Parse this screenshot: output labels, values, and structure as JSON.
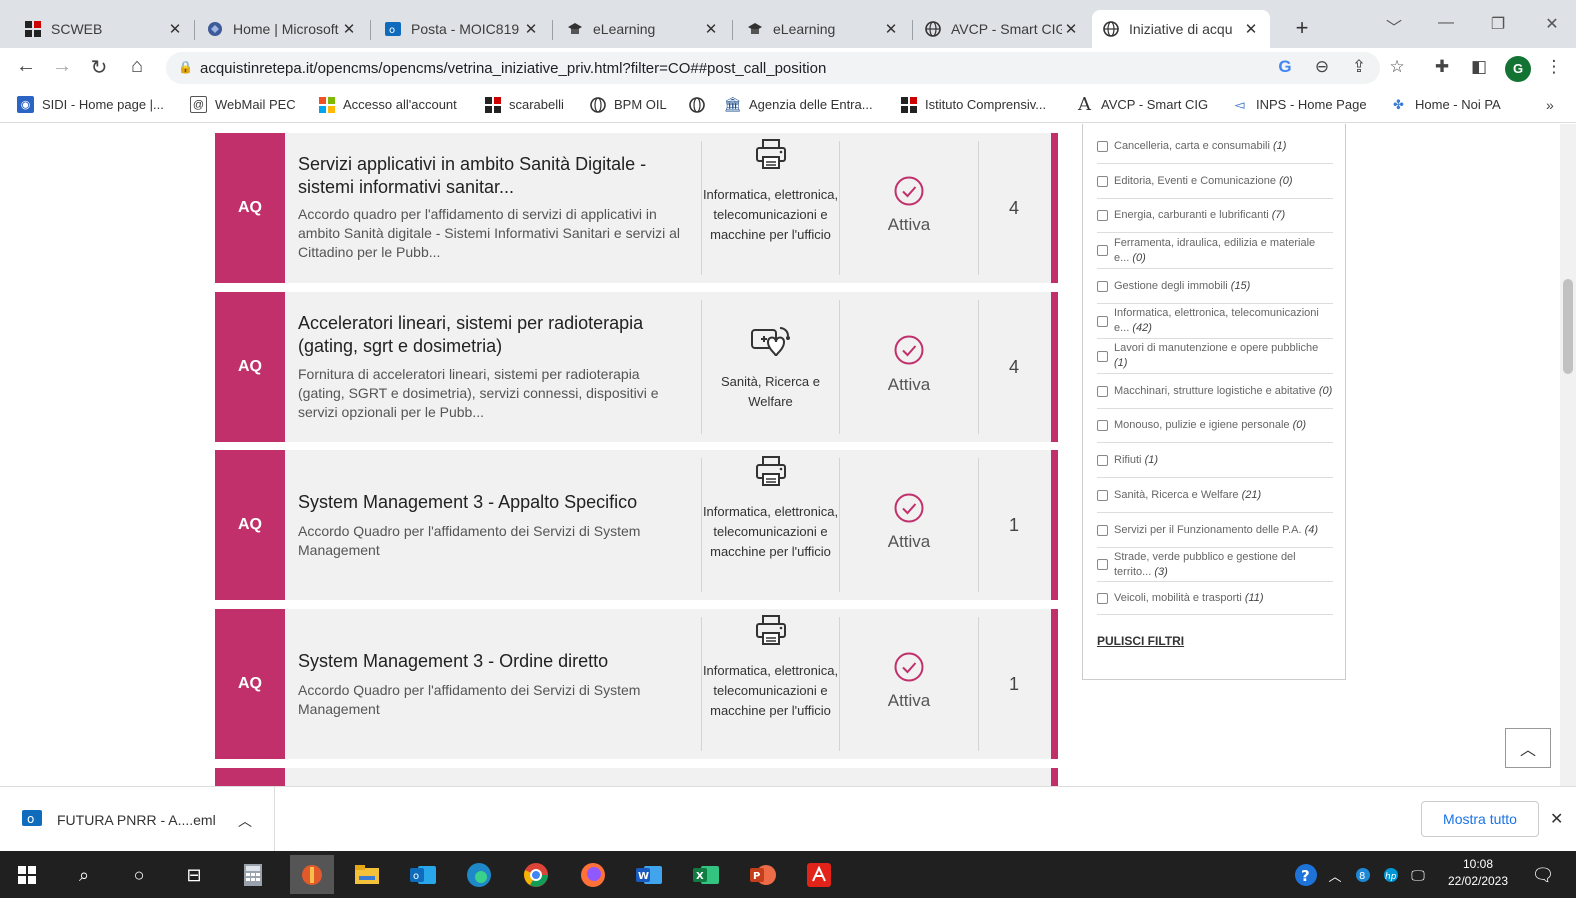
{
  "browser": {
    "tabs": [
      {
        "title": "SCWEB",
        "icon": "scweb-icon",
        "active": false
      },
      {
        "title": "Home | Microsoft",
        "icon": "microsoft-office-icon",
        "active": false
      },
      {
        "title": "Posta - MOIC819",
        "icon": "outlook-icon",
        "active": false
      },
      {
        "title": "eLearning",
        "icon": "elearning-icon",
        "active": false
      },
      {
        "title": "eLearning",
        "icon": "elearning-icon",
        "active": false
      },
      {
        "title": "AVCP - Smart CIG",
        "icon": "globe-icon",
        "active": false
      },
      {
        "title": "Iniziative di acqu",
        "icon": "globe-icon",
        "active": true
      }
    ],
    "url": "acquistinretepa.it/opencms/opencms/vetrina_iniziative_priv.html?filter=CO##post_call_position",
    "profile_initial": "G",
    "bookmarks": [
      {
        "label": "SIDI - Home page |...",
        "icon": "sidi-icon"
      },
      {
        "label": "WebMail PEC",
        "icon": "webmail-icon"
      },
      {
        "label": "Accesso all'account",
        "icon": "microsoft-icon"
      },
      {
        "label": "scarabelli",
        "icon": "scarabelli-icon"
      },
      {
        "label": "BPM OIL",
        "icon": "globe-icon"
      },
      {
        "label": "",
        "icon": "globe-icon"
      },
      {
        "label": "Agenzia delle Entra...",
        "icon": "agenzia-icon"
      },
      {
        "label": "Istituto Comprensiv...",
        "icon": "istituto-icon"
      },
      {
        "label": "AVCP - Smart CIG",
        "icon": "avcp-icon"
      },
      {
        "label": "INPS - Home Page",
        "icon": "inps-icon"
      },
      {
        "label": "Home - Noi PA",
        "icon": "noipa-icon"
      }
    ]
  },
  "initiatives": [
    {
      "badge": "AQ",
      "title": "Servizi applicativi in ambito Sanità Digitale - sistemi informativi sanitar...",
      "description": "Accordo quadro per l'affidamento di servizi di applicativi in ambito Sanità digitale - Sistemi Informativi Sanitari e servizi al Cittadino per le Pubb...",
      "category": "Informatica, elettronica, telecomunicazioni e macchine per l'ufficio",
      "category_icon": "printer-icon",
      "status": "Attiva",
      "count": "4"
    },
    {
      "badge": "AQ",
      "title": "Acceleratori lineari, sistemi per radioterapia (gating, sgrt e dosimetria)",
      "description": "Fornitura di acceleratori lineari, sistemi per radioterapia (gating, SGRT e dosimetria), servizi connessi, dispositivi e servizi opzionali per le Pubb...",
      "category": "Sanità, Ricerca e Welfare",
      "category_icon": "health-icon",
      "status": "Attiva",
      "count": "4"
    },
    {
      "badge": "AQ",
      "title": "System Management 3 - Appalto Specifico",
      "description": "Accordo Quadro per l'affidamento dei Servizi di System Management",
      "category": "Informatica, elettronica, telecomunicazioni e macchine per l'ufficio",
      "category_icon": "printer-icon",
      "status": "Attiva",
      "count": "1"
    },
    {
      "badge": "AQ",
      "title": "System Management 3 - Ordine diretto",
      "description": "Accordo Quadro per l'affidamento dei Servizi di System Management",
      "category": "Informatica, elettronica, telecomunicazioni e macchine per l'ufficio",
      "category_icon": "printer-icon",
      "status": "Attiva",
      "count": "1"
    }
  ],
  "filters": {
    "items": [
      {
        "label": "Cancelleria, carta e consumabili",
        "count": "(1)"
      },
      {
        "label": "Editoria, Eventi e Comunicazione",
        "count": "(0)"
      },
      {
        "label": "Energia, carburanti e lubrificanti",
        "count": "(7)"
      },
      {
        "label": "Ferramenta, idraulica, edilizia e materiale e...",
        "count": "(0)"
      },
      {
        "label": "Gestione degli immobili",
        "count": "(15)"
      },
      {
        "label": "Informatica, elettronica, telecomunicazioni e...",
        "count": "(42)"
      },
      {
        "label": "Lavori di manutenzione e opere pubbliche",
        "count": "(1)"
      },
      {
        "label": "Macchinari, strutture logistiche e abitative",
        "count": "(0)"
      },
      {
        "label": "Monouso, pulizie e igiene personale",
        "count": "(0)"
      },
      {
        "label": "Rifiuti",
        "count": "(1)"
      },
      {
        "label": "Sanità, Ricerca e Welfare",
        "count": "(21)"
      },
      {
        "label": "Servizi per il Funzionamento delle P.A.",
        "count": "(4)"
      },
      {
        "label": "Strade, verde pubblico e gestione del territo...",
        "count": "(3)"
      },
      {
        "label": "Veicoli, mobilità e trasporti",
        "count": "(11)"
      }
    ],
    "clear_label": "PULISCI FILTRI"
  },
  "downloads": {
    "file": "FUTURA PNRR - A....eml",
    "show_all": "Mostra tutto"
  },
  "taskbar": {
    "time": "10:08",
    "date": "22/02/2023"
  },
  "colors": {
    "accent": "#c1306b",
    "card_bg": "#f1f1f1"
  }
}
